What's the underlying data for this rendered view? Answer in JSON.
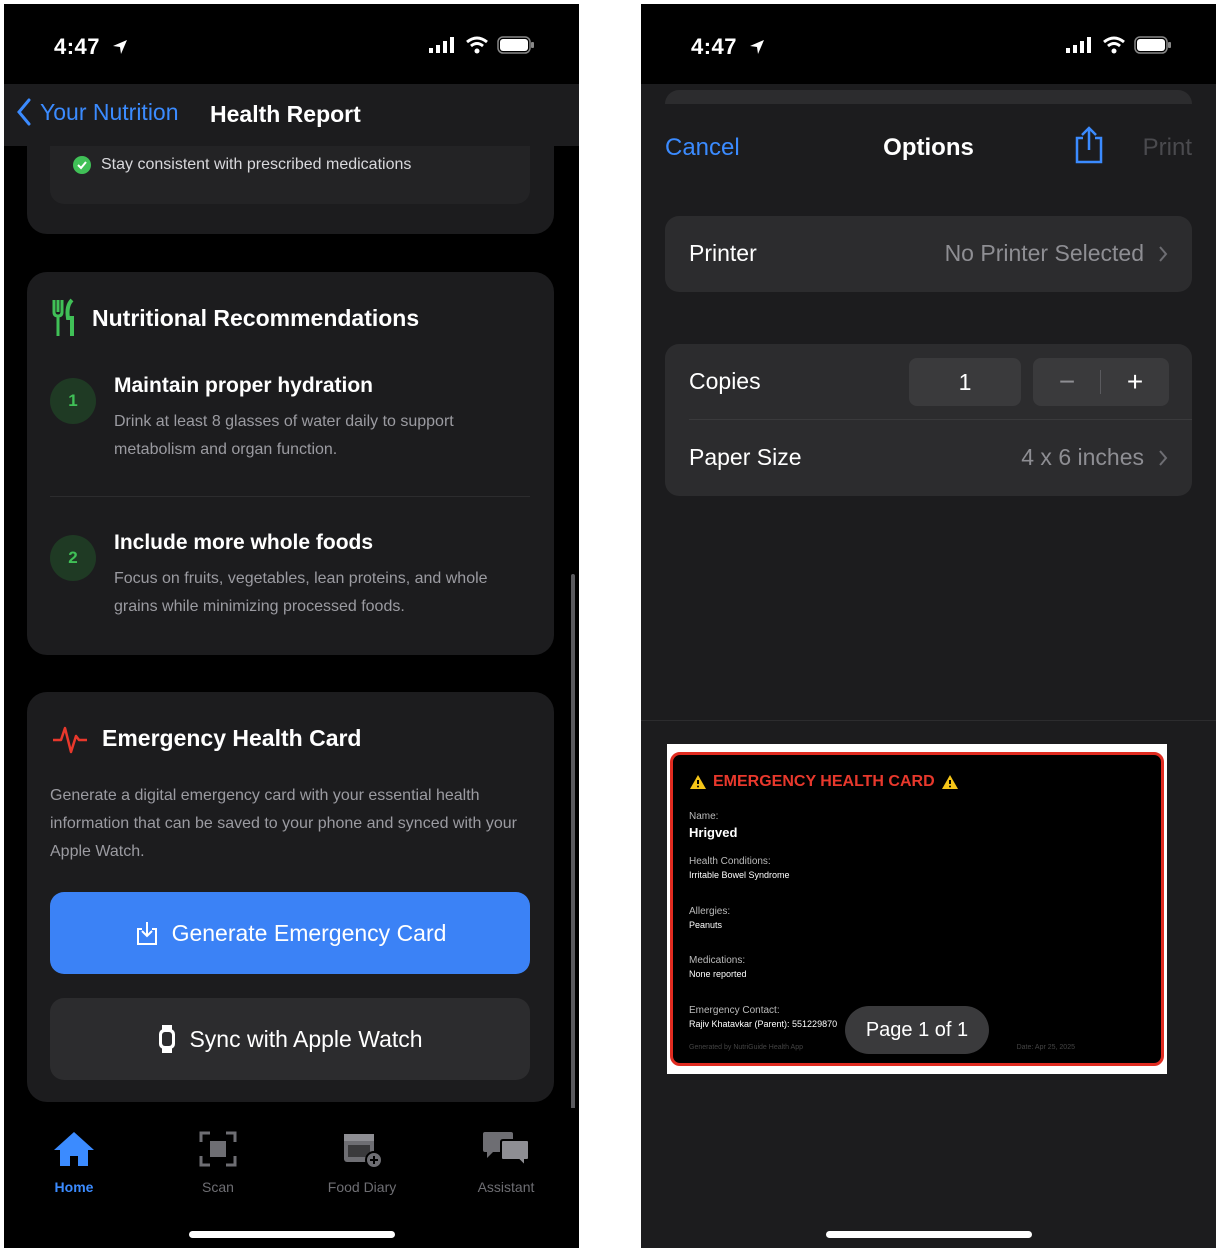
{
  "left": {
    "status": {
      "time": "4:47"
    },
    "nav": {
      "back_label": "Your Nutrition",
      "title": "Health Report"
    },
    "top_item": "Stay consistent with prescribed medications",
    "recommendations": {
      "title": "Nutritional Recommendations",
      "items": [
        {
          "num": "1",
          "title": "Maintain proper hydration",
          "desc": "Drink at least 8 glasses of water daily to support metabolism and organ function."
        },
        {
          "num": "2",
          "title": "Include more whole foods",
          "desc": "Focus on fruits, vegetables, lean proteins, and whole grains while minimizing processed foods."
        }
      ]
    },
    "emergency": {
      "title": "Emergency Health Card",
      "desc": "Generate a digital emergency card with your essential health information that can be saved to your phone and synced with your Apple Watch.",
      "generate_label": "Generate Emergency Card",
      "sync_label": "Sync with Apple Watch"
    },
    "tabs": [
      {
        "label": "Home",
        "icon": "house-icon",
        "active": true
      },
      {
        "label": "Scan",
        "icon": "scan-icon",
        "active": false
      },
      {
        "label": "Food Diary",
        "icon": "calendar-add-icon",
        "active": false
      },
      {
        "label": "Assistant",
        "icon": "chat-bubbles-icon",
        "active": false
      }
    ]
  },
  "right": {
    "status": {
      "time": "4:47"
    },
    "sheet": {
      "cancel": "Cancel",
      "title": "Options",
      "print": "Print"
    },
    "printer": {
      "label": "Printer",
      "value": "No Printer Selected"
    },
    "copies": {
      "label": "Copies",
      "value": "1"
    },
    "paper_size": {
      "label": "Paper Size",
      "value": "4 x 6 inches"
    },
    "preview": {
      "header": "EMERGENCY HEALTH CARD",
      "name_label": "Name:",
      "name": "Hrigved",
      "conditions_label": "Health Conditions:",
      "conditions": "Irritable Bowel Syndrome",
      "allergies_label": "Allergies:",
      "allergies": "Peanuts",
      "medications_label": "Medications:",
      "medications": "None reported",
      "contact_label": "Emergency Contact:",
      "contact": "Rajiv Khatavkar (Parent): 551229870",
      "footer_left": "Generated by NutriGuide Health App",
      "footer_right": "Date: Apr 25, 2025",
      "page_badge": "Page 1 of 1"
    }
  },
  "colors": {
    "accent": "#3b8bff",
    "primary_button": "#3b82f6",
    "success": "#40c057",
    "danger": "#e02b20"
  }
}
